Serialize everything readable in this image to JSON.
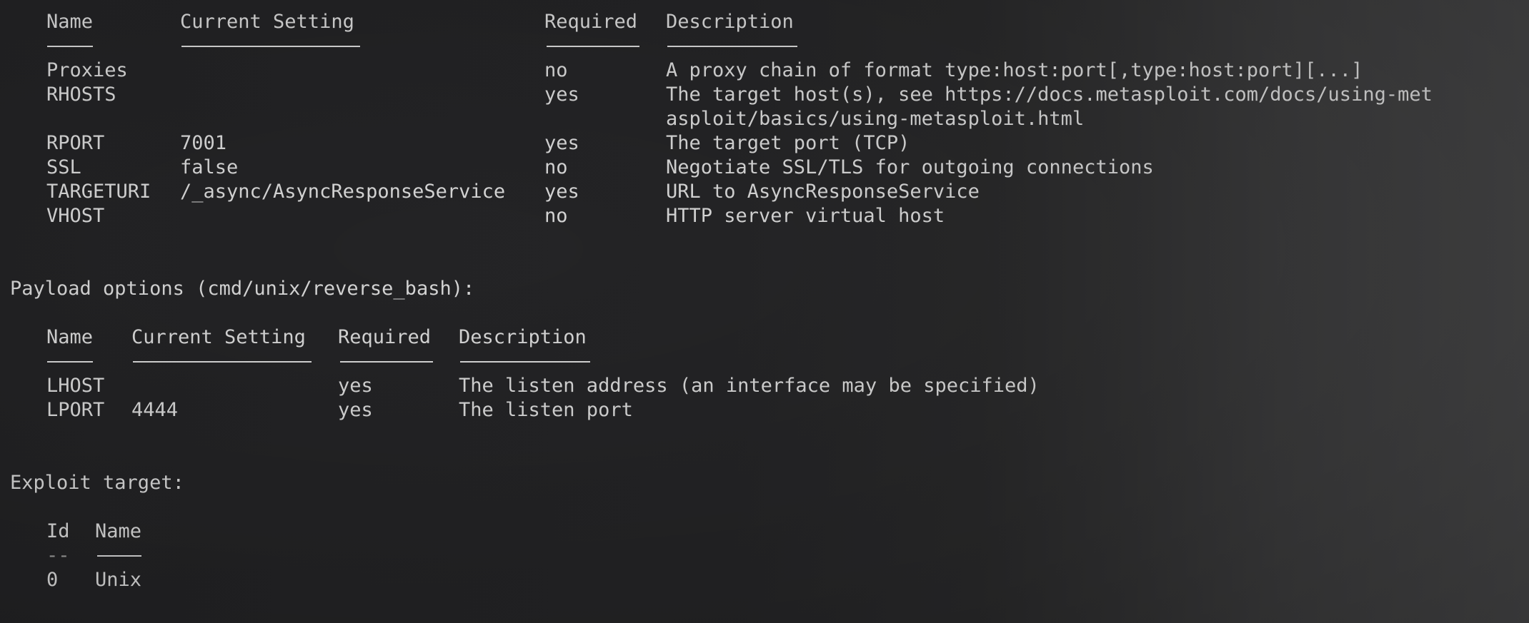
{
  "module_options": {
    "headers": {
      "name": "Name",
      "current_setting": "Current Setting",
      "required": "Required",
      "description": "Description"
    },
    "rows": [
      {
        "name": "Proxies",
        "setting": "",
        "required": "no",
        "description": "A proxy chain of format type:host:port[,type:host:port][...]"
      },
      {
        "name": "RHOSTS",
        "setting": "",
        "required": "yes",
        "description": "The target host(s), see https://docs.metasploit.com/docs/using-met",
        "description_cont": "asploit/basics/using-metasploit.html"
      },
      {
        "name": "RPORT",
        "setting": "7001",
        "required": "yes",
        "description": "The target port (TCP)"
      },
      {
        "name": "SSL",
        "setting": "false",
        "required": "no",
        "description": "Negotiate SSL/TLS for outgoing connections"
      },
      {
        "name": "TARGETURI",
        "setting": "/_async/AsyncResponseService",
        "required": "yes",
        "description": "URL to AsyncResponseService"
      },
      {
        "name": "VHOST",
        "setting": "",
        "required": "no",
        "description": "HTTP server virtual host"
      }
    ]
  },
  "payload_options": {
    "title": "Payload options (cmd/unix/reverse_bash):",
    "headers": {
      "name": "Name",
      "current_setting": "Current Setting",
      "required": "Required",
      "description": "Description"
    },
    "rows": [
      {
        "name": "LHOST",
        "setting": "",
        "required": "yes",
        "description": "The listen address (an interface may be specified)"
      },
      {
        "name": "LPORT",
        "setting": "4444",
        "required": "yes",
        "description": "The listen port"
      }
    ]
  },
  "exploit_target": {
    "title": "Exploit target:",
    "headers": {
      "id": "Id",
      "name": "Name"
    },
    "underline_id": "--",
    "rows": [
      {
        "id": "0",
        "name": "Unix"
      }
    ]
  },
  "colors": {
    "text": "#d6d6d6",
    "background": "#242426"
  }
}
